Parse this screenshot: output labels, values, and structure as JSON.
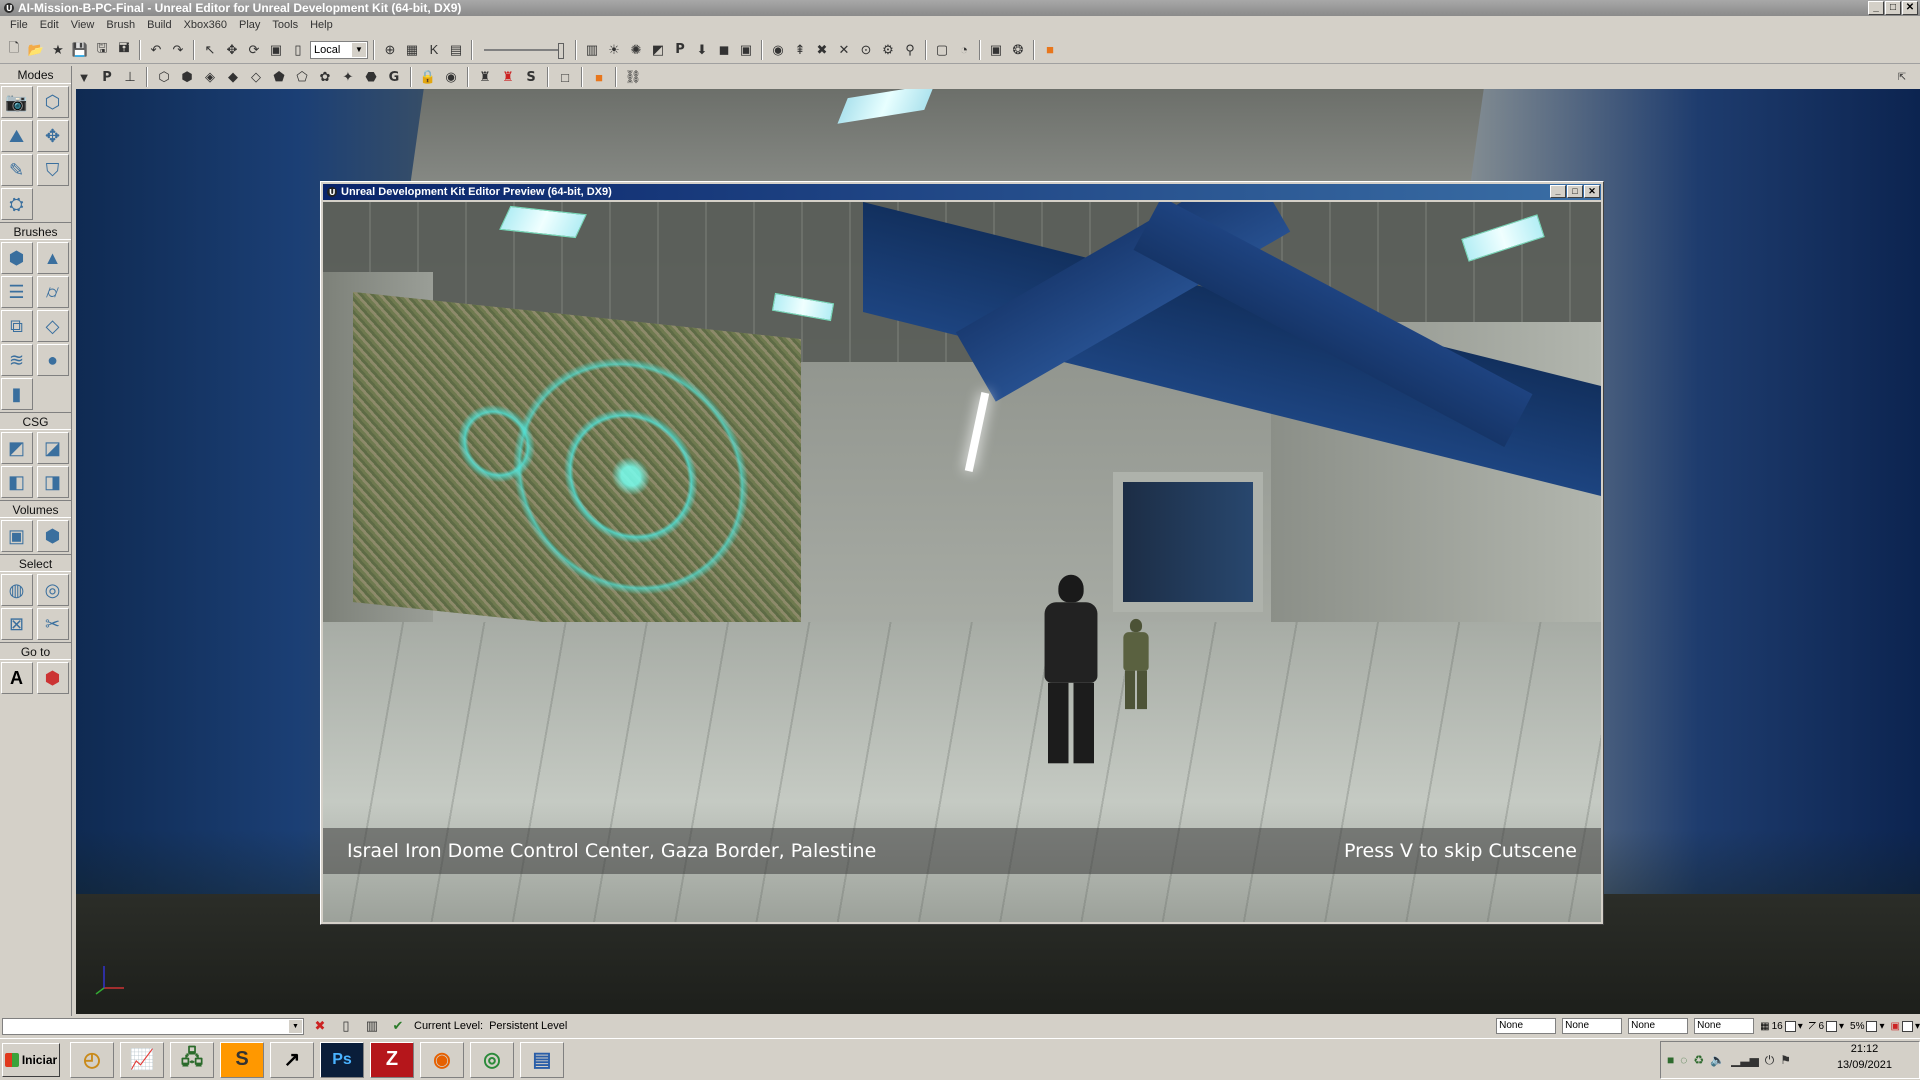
{
  "window": {
    "title": "AI-Mission-B-PC-Final - Unreal Editor for Unreal Development Kit (64-bit, DX9)",
    "controls": [
      "_",
      "□",
      "✕"
    ]
  },
  "menu": [
    "File",
    "Edit",
    "View",
    "Brush",
    "Build",
    "Xbox360",
    "Play",
    "Tools",
    "Help"
  ],
  "toolbar": {
    "coordinate_system": "Local"
  },
  "toolbar2": {
    "p_label": "P",
    "g_label": "G",
    "s_label": "S"
  },
  "modes_panel": {
    "modes_label": "Modes",
    "brushes_label": "Brushes",
    "csg_label": "CSG",
    "volumes_label": "Volumes",
    "select_label": "Select",
    "goto_label": "Go to"
  },
  "preview": {
    "title": "Unreal Development Kit Editor Preview (64-bit, DX9)",
    "caption_left": "Israel Iron Dome Control Center, Gaza Border, Palestine",
    "caption_right": "Press V to skip Cutscene"
  },
  "statusbar": {
    "current_level_label": "Current Level:",
    "current_level_value": "Persistent Level",
    "fields": [
      "None",
      "None",
      "None",
      "None"
    ],
    "grid_size": "16",
    "rotation_snap": "6",
    "scale_snap": "5%"
  },
  "taskbar": {
    "start_label": "Iniciar",
    "apps": [
      "clock-app",
      "chart-app",
      "network-app",
      "sublime-app",
      "unreal-app",
      "Ps",
      "filezilla-app",
      "firefox-app",
      "chrome-app",
      "explorer-app"
    ],
    "clock_time": "21:12",
    "clock_date": "13/09/2021"
  }
}
